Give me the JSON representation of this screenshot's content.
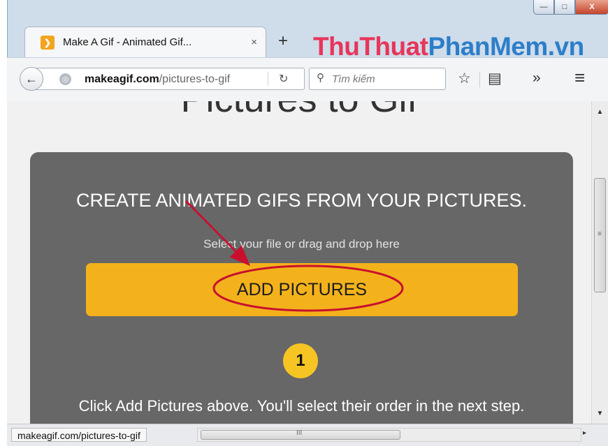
{
  "window": {
    "controls": {
      "minimize": "—",
      "maximize": "□",
      "close": "X"
    }
  },
  "tab": {
    "favicon_glyph": "❯",
    "title": "Make A Gif - Animated Gif...",
    "close": "×",
    "new_tab": "+"
  },
  "watermark": {
    "part1": "ThuThuat",
    "part2": "PhanMem.vn"
  },
  "navbar": {
    "back": "←",
    "globe": "◎",
    "url_domain": "makeagif.com",
    "url_path": "/pictures-to-gif",
    "reload": "↻",
    "search_icon": "⚲",
    "search_placeholder": "Tìm kiếm",
    "bookmark_star": "☆",
    "reading_list": "▤",
    "overflow": "»",
    "menu": "≡"
  },
  "page": {
    "heading": "Pictures to Gif",
    "headline": "CREATE ANIMATED GIFS FROM YOUR PICTURES.",
    "subtext": "Select your file or drag and drop here",
    "add_button": "ADD PICTURES",
    "step_number": "1",
    "instruction": "Click Add Pictures above. You'll select their order in the next step."
  },
  "statusbar": {
    "link": "makeagif.com/pictures-to-gif",
    "hscroll_grip": "III",
    "hscroll_right": "▸",
    "vscroll_up": "▲",
    "vscroll_down": "▼",
    "vscroll_grip": "≡"
  },
  "colors": {
    "accent_button": "#f3b21b",
    "card_bg": "#676767",
    "annotation_red": "#c8102e",
    "badge": "#f7c523",
    "watermark_pink": "#e8355a",
    "watermark_blue": "#2d7ec9"
  }
}
